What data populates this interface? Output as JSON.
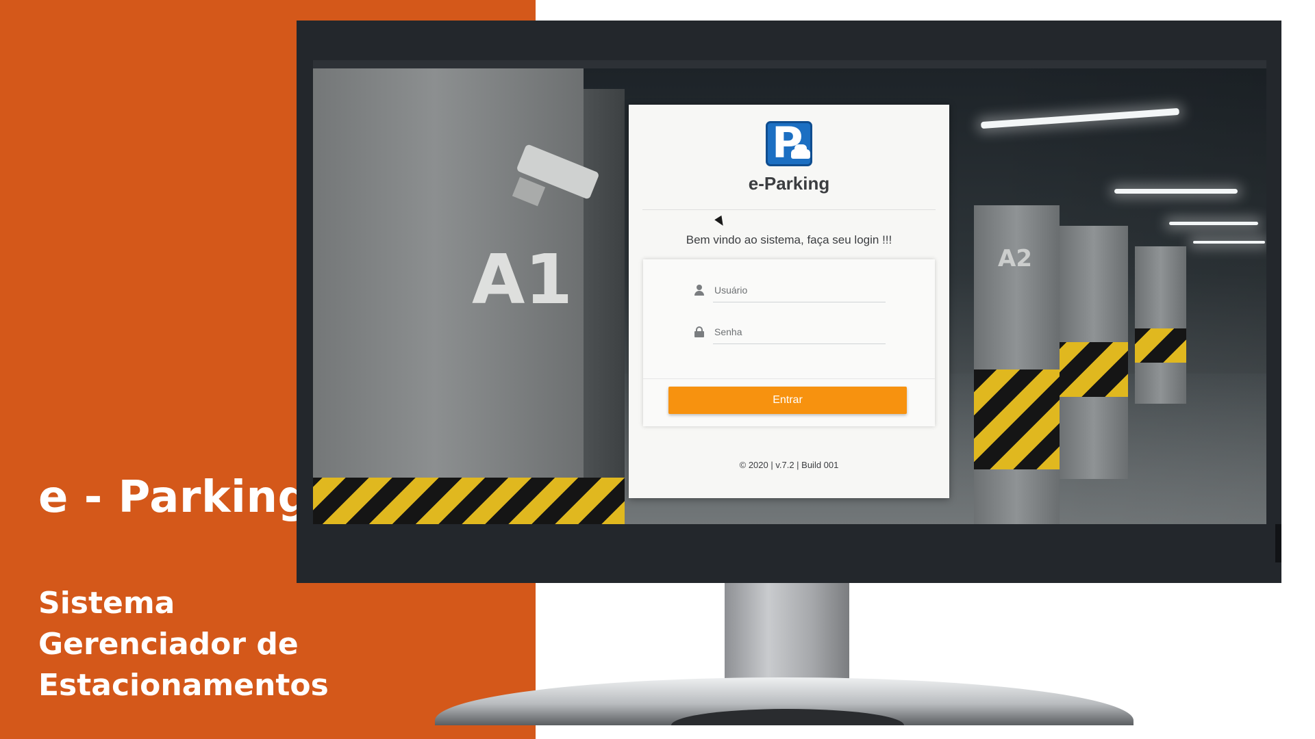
{
  "promo": {
    "title": "e - Parking",
    "subtitle_lines": [
      "Sistema",
      "Gerenciador de",
      "Estacionamentos"
    ],
    "background_color": "#d4581a"
  },
  "screen": {
    "pillar_labels": [
      "A1",
      "A2"
    ]
  },
  "login": {
    "logo_letter": "P",
    "brand": "e-Parking",
    "welcome": "Bem vindo ao sistema, faça seu login !!!",
    "username_placeholder": "Usuário",
    "password_placeholder": "Senha",
    "submit_label": "Entrar",
    "footer": "© 2020 | v.7.2 | Build 001",
    "icons": [
      "user-icon",
      "lock-icon"
    ],
    "accent_color": "#f7920f"
  }
}
